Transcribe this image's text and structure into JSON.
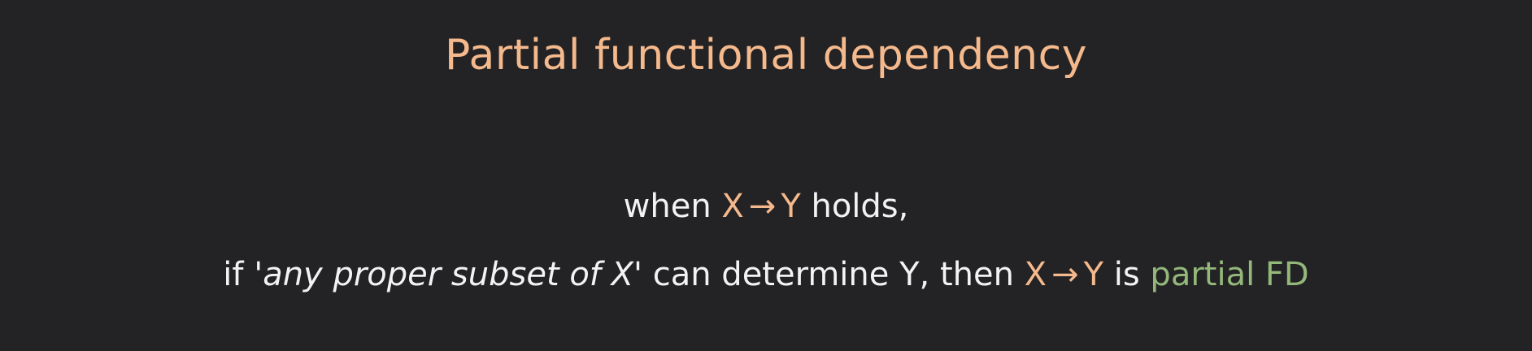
{
  "colors": {
    "background": "#232224",
    "accent": "#f4b98c",
    "text": "#f3f3f3",
    "highlight": "#93b87a"
  },
  "title": "Partial functional dependency",
  "line1": {
    "prefix": "when",
    "x": "X",
    "arrow": "→",
    "y": "Y",
    "suffix": "holds,"
  },
  "line2": {
    "prefix": "if '",
    "italic_phrase": "any proper subset of X",
    "quote_close": "'",
    "middle": "can determine Y, then",
    "x": "X",
    "arrow": "→",
    "y": "Y",
    "is": "is",
    "result": "partial FD"
  }
}
